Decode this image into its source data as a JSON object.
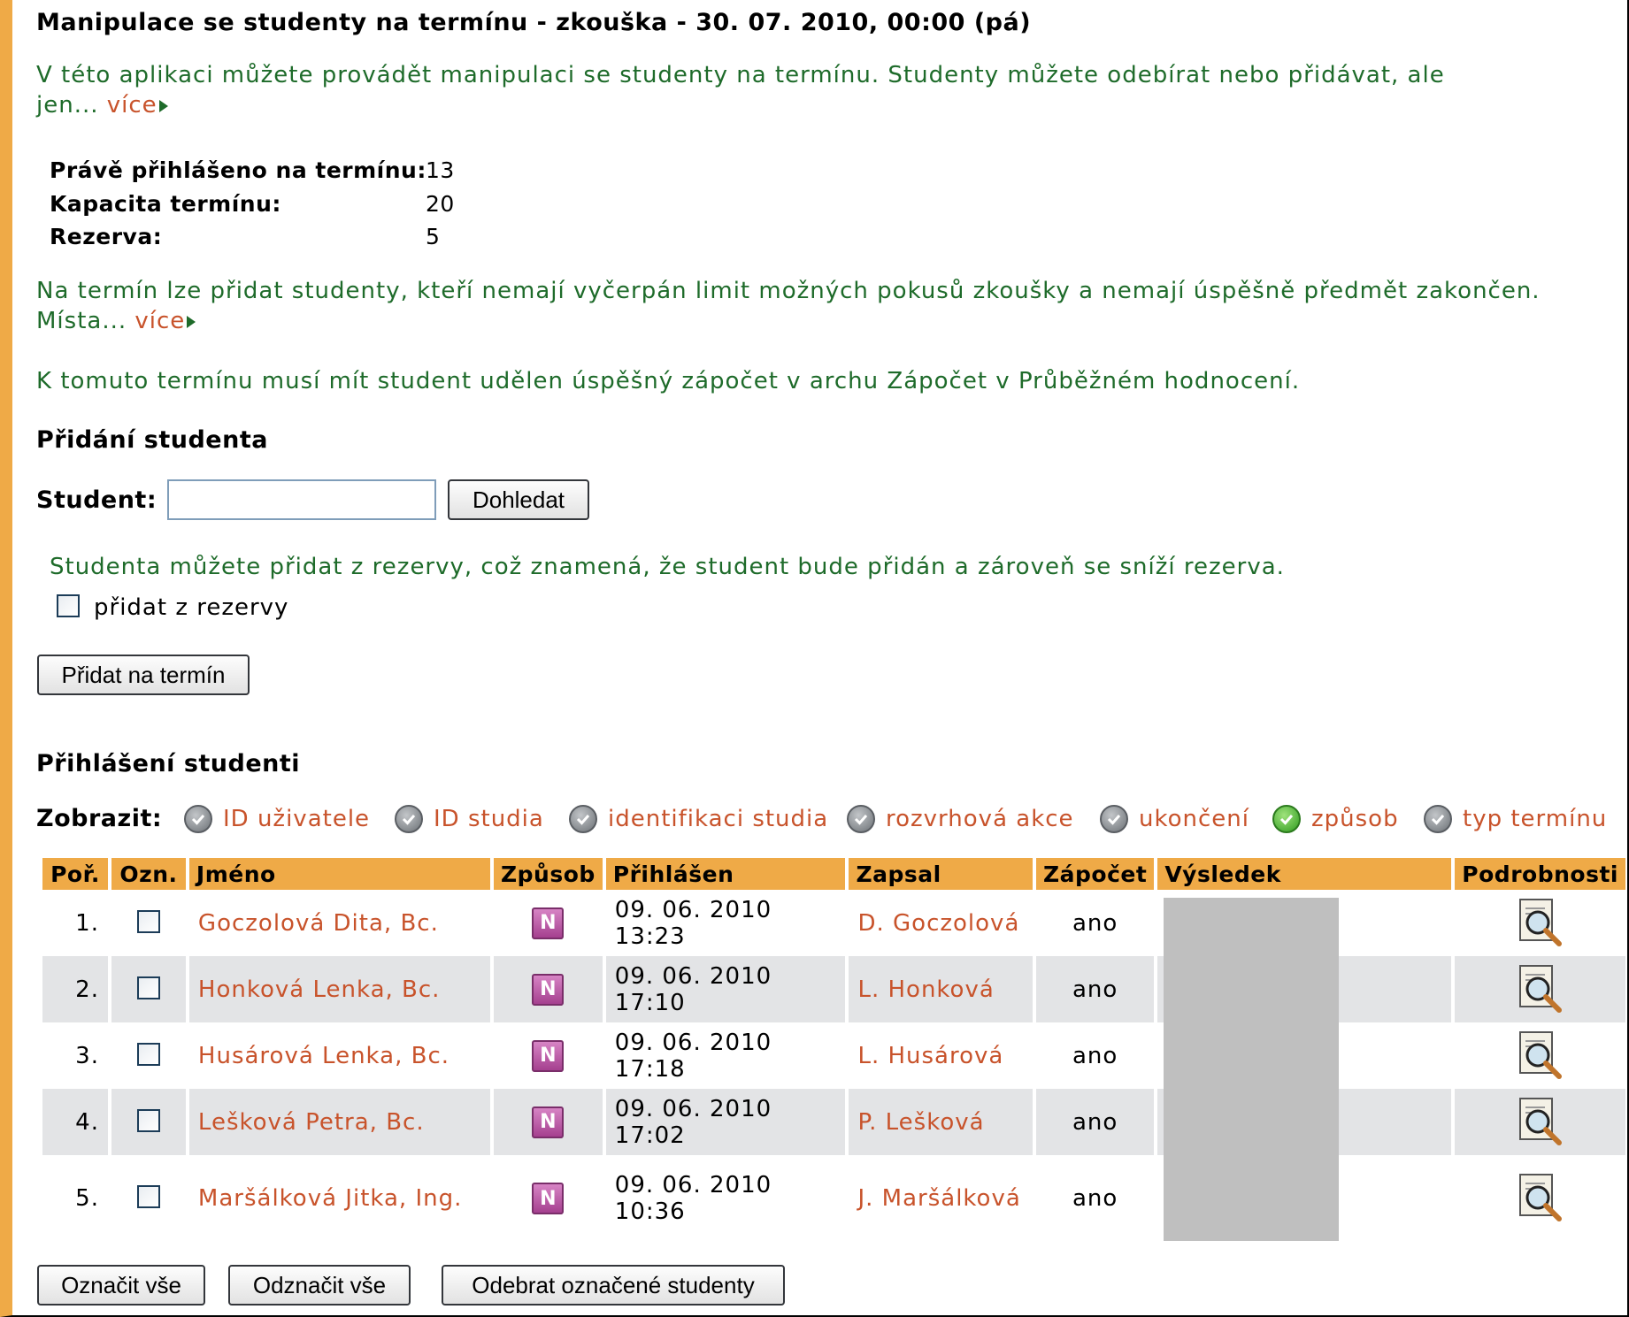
{
  "title": "Manipulace se studenty na termínu - zkouška - 30. 07. 2010, 00:00 (pá)",
  "intro": {
    "line1": "V této aplikaci můžete provádět manipulaci se studenty na termínu. Studenty můžete odebírat nebo přidávat, ale",
    "line2": "jen... ",
    "more": "více"
  },
  "summary": [
    {
      "label": "Právě přihlášeno na termínu:",
      "value": "13"
    },
    {
      "label": "Kapacita termínu:",
      "value": "20"
    },
    {
      "label": "Rezerva:",
      "value": "5"
    }
  ],
  "rule_text": {
    "line1": "Na termín lze přidat studenty, kteří nemají vyčerpán limit možných pokusů zkoušky a nemají úspěšně předmět zakončen.",
    "line2": "Místa... ",
    "more": "více"
  },
  "credit_note": "K tomuto termínu musí mít student udělen úspěšný zápočet v archu Zápočet v Průběžném hodnocení.",
  "add_section": {
    "heading": "Přidání studenta",
    "student_label": "Student:",
    "student_value": "",
    "search_button": "Dohledat",
    "reserve_note": "Studenta můžete přidat z rezervy, což znamená, že student bude přidán a zároveň se sníží rezerva.",
    "reserve_checkbox_label": "přidat z rezervy",
    "add_button": "Přidat na termín"
  },
  "registered": {
    "heading": "Přihlášení studenti",
    "show_label": "Zobrazit:",
    "filters": [
      {
        "label": "ID uživatele",
        "icon": "check-grey-icon"
      },
      {
        "label": "ID studia",
        "icon": "check-grey-icon"
      },
      {
        "label": "identifikaci studia",
        "icon": "check-grey-icon"
      },
      {
        "label": "rozvrhová akce",
        "icon": "check-grey-icon"
      },
      {
        "label": "ukončení",
        "icon": "check-grey-icon"
      },
      {
        "label": "způsob",
        "icon": "check-green-icon"
      },
      {
        "label": "typ termínu",
        "icon": "check-grey-icon"
      }
    ],
    "columns": [
      "Poř.",
      "Ozn.",
      "Jméno",
      "Způsob",
      "Přihlášen",
      "Zapsal",
      "Zápočet",
      "Výsledek",
      "Podrobnosti"
    ],
    "rows": [
      {
        "order": "1.",
        "name": "Goczolová Dita, Bc.",
        "mode": "N",
        "registered": "09. 06. 2010 13:23",
        "by": "D. Goczolová",
        "credit": "ano"
      },
      {
        "order": "2.",
        "name": "Honková Lenka, Bc.",
        "mode": "N",
        "registered": "09. 06. 2010 17:10",
        "by": "L. Honková",
        "credit": "ano"
      },
      {
        "order": "3.",
        "name": "Husárová Lenka, Bc.",
        "mode": "N",
        "registered": "09. 06. 2010 17:18",
        "by": "L. Husárová",
        "credit": "ano"
      },
      {
        "order": "4.",
        "name": "Lešková Petra, Bc.",
        "mode": "N",
        "registered": "09. 06. 2010 17:02",
        "by": "P. Lešková",
        "credit": "ano"
      },
      {
        "order": "5.",
        "name": "Maršálková Jitka, Ing.",
        "mode": "N",
        "registered": "09. 06. 2010 10:36",
        "by": "J. Maršálková",
        "credit": "ano"
      }
    ],
    "buttons": {
      "select_all": "Označit vše",
      "deselect_all": "Odznačit vše",
      "remove_selected": "Odebrat označené studenty"
    }
  },
  "colors": {
    "accent": "#efaa47",
    "green_text": "#1e6b2a",
    "link": "#c8532b",
    "row_alt": "#e3e4e6"
  }
}
